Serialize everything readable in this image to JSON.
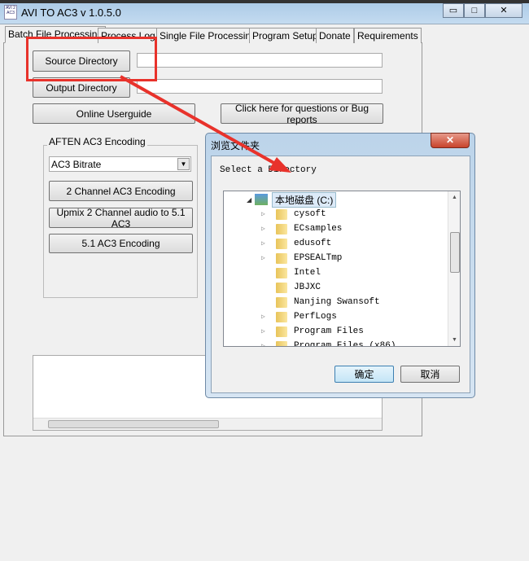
{
  "window": {
    "title": "AVI TO AC3 v 1.0.5.0",
    "icon_text": "AVI 2 AC3",
    "minimize": "▭",
    "maximize": "□",
    "close": "✕"
  },
  "tabs": [
    {
      "label": "Batch File Processing",
      "active": true
    },
    {
      "label": "Process Log"
    },
    {
      "label": "Single File Processing"
    },
    {
      "label": "Program Setup"
    },
    {
      "label": "Donate"
    },
    {
      "label": "Requirements"
    }
  ],
  "batch": {
    "source_dir_label": "Source Directory",
    "source_dir_value": "",
    "output_dir_label": "Output Directory",
    "output_dir_value": "",
    "userguide_label": "Online Userguide",
    "bug_label": "Click here for questions or Bug reports",
    "group_label": "AFTEN AC3 Encoding",
    "bitrate_selected": "AC3 Bitrate",
    "btn_2ch": "2 Channel AC3 Encoding",
    "btn_upmix": "Upmix 2 Channel audio to 5.1 AC3",
    "btn_51": "5.1 AC3 Encoding",
    "log_text": ""
  },
  "annotation": {
    "color": "#e8322b"
  },
  "dialog": {
    "title": "浏览文件夹",
    "close": "✕",
    "prompt": "Select a Directory",
    "root": "本地磁盘 (C:)",
    "folders": [
      {
        "name": "cysoft",
        "expandable": true
      },
      {
        "name": "ECsamples",
        "expandable": true
      },
      {
        "name": "edusoft",
        "expandable": true
      },
      {
        "name": "EPSEALTmp",
        "expandable": true
      },
      {
        "name": "Intel",
        "expandable": false
      },
      {
        "name": "JBJXC",
        "expandable": false
      },
      {
        "name": "Nanjing Swansoft",
        "expandable": false
      },
      {
        "name": "PerfLogs",
        "expandable": true
      },
      {
        "name": "Program Files",
        "expandable": true
      },
      {
        "name": "Program Files (x86)",
        "expandable": true
      }
    ],
    "ok": "确定",
    "cancel": "取消"
  }
}
